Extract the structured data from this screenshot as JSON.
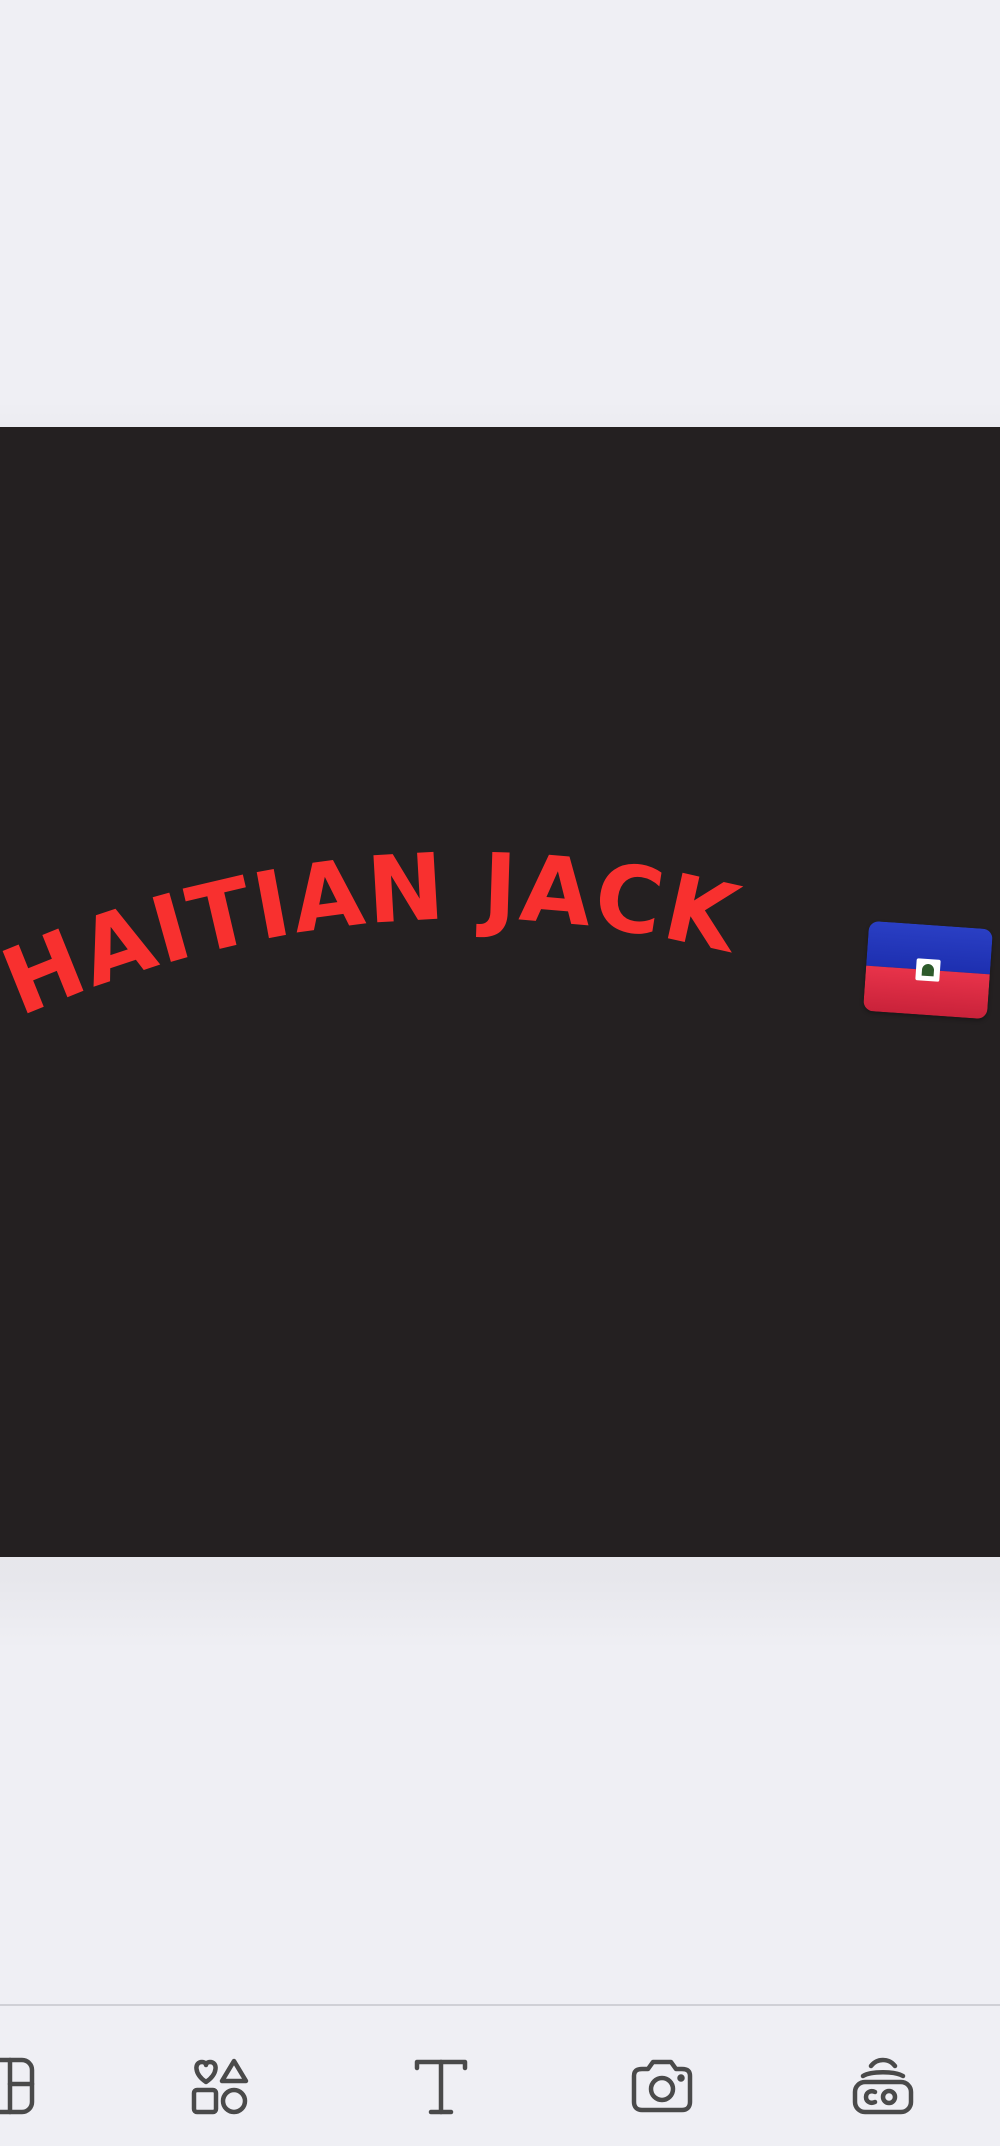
{
  "canvas": {
    "background_color": "#242021",
    "curved_text": "HAITIAN JACK",
    "text_color": "#f8302f",
    "flag_emoji": "haiti-flag"
  },
  "toolbar": {
    "tools": [
      {
        "name": "layout-icon"
      },
      {
        "name": "elements-icon"
      },
      {
        "name": "text-icon"
      },
      {
        "name": "camera-icon"
      },
      {
        "name": "background-remover-icon"
      }
    ]
  }
}
